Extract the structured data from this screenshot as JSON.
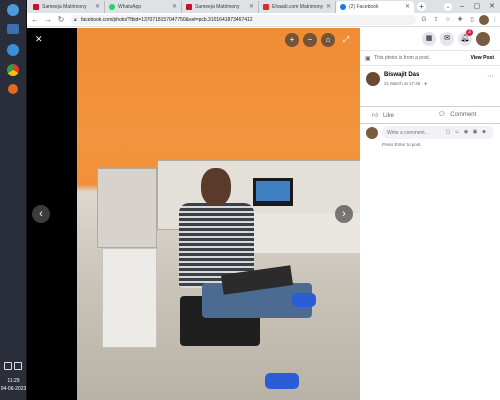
{
  "taskbar": {
    "time": "11:29",
    "date": "04-06-2023"
  },
  "browser": {
    "tabs": [
      {
        "label": "Sameeja Matrimony",
        "active": false
      },
      {
        "label": "WhatsApp",
        "active": false
      },
      {
        "label": "Sameeja Matrimony",
        "active": false
      },
      {
        "label": "Ehaadi.com Matrimony",
        "active": false
      },
      {
        "label": "(2) Facebook",
        "active": true
      }
    ],
    "new_tab_label": "+",
    "url": "facebook.com/photo/?fbid=1370718157047750&set=pcb.3101641873467412"
  },
  "viewer": {
    "close_label": "✕",
    "next_label": "›",
    "prev_label": "‹"
  },
  "panel": {
    "info_text": "This photo is from a post.",
    "view_post": "View Post",
    "author": "Biswajit Das",
    "time": "21 March at 17:46",
    "like": "Like",
    "comment": "Comment",
    "comment_placeholder": "Write a comment...",
    "hint": "Press Enter to post.",
    "notification_count": "2"
  },
  "colors": {
    "facebook_blue": "#1877f2",
    "orange_wall": "#f08c34",
    "badge_red": "#e41e3f"
  }
}
